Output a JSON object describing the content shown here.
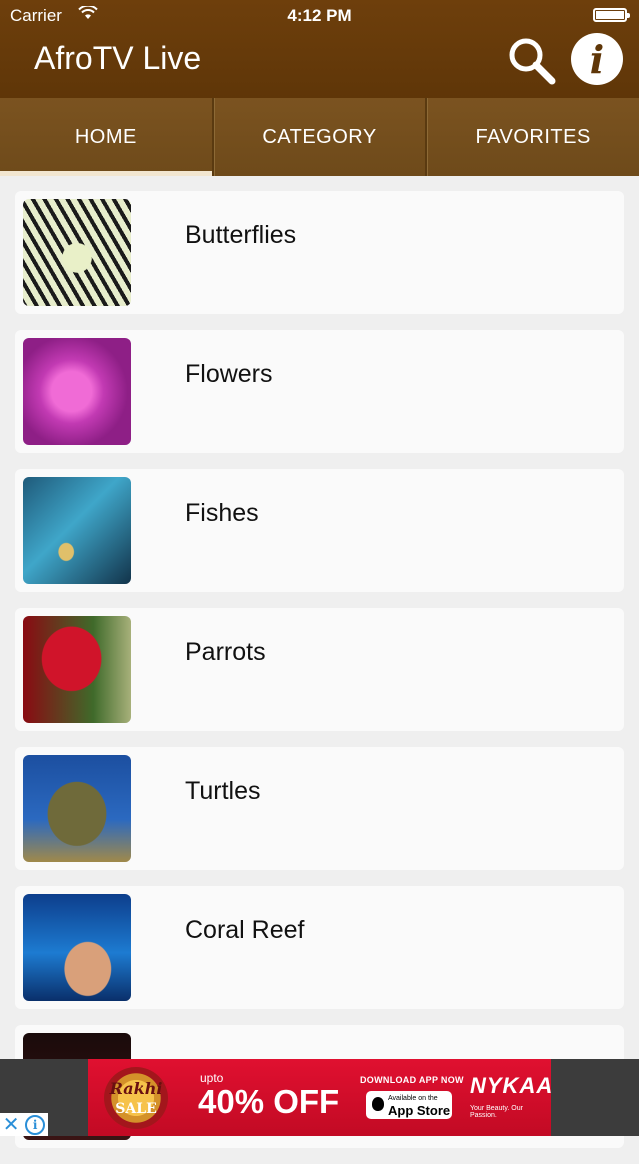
{
  "status_bar": {
    "carrier": "Carrier",
    "time": "4:12 PM"
  },
  "header": {
    "title": "AfroTV Live",
    "search_icon": "search-icon",
    "info_icon": "info-icon",
    "info_glyph": "i"
  },
  "tabs": [
    {
      "label": "HOME",
      "active": true
    },
    {
      "label": "CATEGORY",
      "active": false
    },
    {
      "label": "FAVORITES",
      "active": false
    }
  ],
  "categories": [
    {
      "label": "Butterflies"
    },
    {
      "label": "Flowers"
    },
    {
      "label": "Fishes"
    },
    {
      "label": "Parrots"
    },
    {
      "label": "Turtles"
    },
    {
      "label": "Coral Reef"
    },
    {
      "label": ""
    }
  ],
  "ad": {
    "badge_line1": "Rakhi",
    "badge_line2": "SALE",
    "upto": "upto",
    "offer": "40% OFF",
    "download": "DOWNLOAD APP NOW",
    "store_small": "Available on the",
    "store_big": "App Store",
    "brand": "NYKAA",
    "brand_tagline": "Your Beauty. Our Passion.",
    "close_glyph": "✕",
    "info_glyph": "i"
  },
  "colors": {
    "header": "#5f3608",
    "tabs": "#7b5320",
    "ad_red": "#e01030"
  }
}
